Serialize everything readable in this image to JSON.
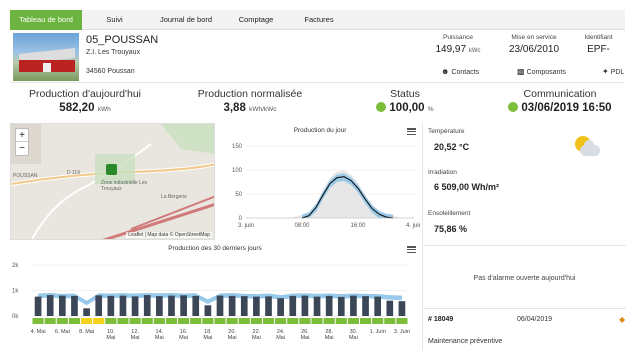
{
  "tabs": [
    {
      "label": "Tableau de bord",
      "active": true
    },
    {
      "label": "Suivi",
      "active": false
    },
    {
      "label": "Journal de bord",
      "active": false
    },
    {
      "label": "Comptage",
      "active": false
    },
    {
      "label": "Factures",
      "active": false
    }
  ],
  "site": {
    "name": "05_POUSSAN",
    "address_line1": "Z.I. Les Trouyaux",
    "address_line2": "34560 Poussan",
    "power_label": "Puissance",
    "power_value": "149,97",
    "power_unit": "kWc",
    "service_label": "Mise en service",
    "service_value": "23/06/2010",
    "id_label": "Identifiant",
    "id_value": "EPF-",
    "contacts_label": "Contacts",
    "components_label": "Composants",
    "pdl_label": "PDL"
  },
  "kpis": {
    "production_label": "Production d'aujourd'hui",
    "production_value": "582,20",
    "production_unit": "kWh",
    "normalized_label": "Production normalisée",
    "normalized_value": "3,88",
    "normalized_unit": "kWh/kWc",
    "status_label": "Status",
    "status_value": "100,00",
    "status_unit": "%",
    "comm_label": "Communication",
    "comm_value": "03/06/2019 16:50",
    "status_color": "#7cbd3a"
  },
  "map": {
    "zoom_in": "+",
    "zoom_out": "−",
    "attribution": "Leaflet | Map data © OpenStreetMap",
    "labels": [
      "D 119",
      "POUSSAN",
      "Zone industrielle Les Trouyaux",
      "La Bergerie"
    ]
  },
  "day_chart": {
    "title": "Production du jour",
    "y_ticks": [
      "150",
      "100",
      "50",
      "0"
    ],
    "x_ticks": [
      "3. juin",
      "08:00",
      "16:00",
      "4. juin"
    ],
    "colors": {
      "line": "#111111",
      "band": "#8cc3e8",
      "reference": "#dddddd"
    }
  },
  "chart_data": [
    {
      "type": "line",
      "title": "Production du jour",
      "xlabel": "",
      "ylabel": "",
      "ylim": [
        0,
        150
      ],
      "x_ticks": [
        "3. juin",
        "08:00",
        "16:00",
        "4. juin"
      ],
      "series": [
        {
          "x": [
            8,
            9,
            10,
            11,
            12,
            13,
            14,
            15,
            16,
            17,
            18,
            19,
            20,
            21
          ],
          "values": [
            0,
            5,
            22,
            48,
            72,
            84,
            86,
            78,
            62,
            40,
            20,
            8,
            2,
            0
          ]
        }
      ]
    },
    {
      "type": "bar",
      "title": "Production des 30 derniers jours",
      "xlabel": "",
      "ylabel": "",
      "ylim": [
        0,
        2000
      ],
      "y_ticks": [
        "2k",
        "1k",
        "0k"
      ],
      "categories": [
        "4. Mai",
        "5",
        "6. Mai",
        "7",
        "8. Mai",
        "9",
        "10. Mai",
        "11",
        "12. Mai",
        "13",
        "14. Mai",
        "15",
        "16. Mai",
        "17",
        "18. Mai",
        "19",
        "20. Mai",
        "21",
        "22. Mai",
        "23",
        "24. Mai",
        "25",
        "26. Mai",
        "27",
        "28. Mai",
        "29",
        "30. Mai",
        "31",
        "1. Juin",
        "2",
        "3. Juin"
      ],
      "values": [
        760,
        820,
        800,
        790,
        300,
        810,
        790,
        800,
        770,
        820,
        780,
        800,
        810,
        790,
        420,
        800,
        790,
        780,
        760,
        770,
        700,
        790,
        800,
        760,
        790,
        750,
        800,
        780,
        760,
        600,
        580
      ],
      "band_values": [
        880,
        900,
        870,
        880,
        600,
        890,
        880,
        900,
        880,
        900,
        890,
        900,
        880,
        890,
        650,
        880,
        900,
        870,
        860,
        880,
        820,
        880,
        890,
        870,
        880,
        860,
        880,
        870,
        860,
        820,
        800
      ],
      "status_colors": [
        "#7cbd3a",
        "#7cbd3a",
        "#7cbd3a",
        "#7cbd3a",
        "#f2d21a",
        "#f2d21a",
        "#7cbd3a",
        "#7cbd3a",
        "#7cbd3a",
        "#7cbd3a",
        "#7cbd3a",
        "#7cbd3a",
        "#7cbd3a",
        "#7cbd3a",
        "#7cbd3a",
        "#7cbd3a",
        "#7cbd3a",
        "#7cbd3a",
        "#7cbd3a",
        "#7cbd3a",
        "#7cbd3a",
        "#7cbd3a",
        "#7cbd3a",
        "#7cbd3a",
        "#7cbd3a",
        "#7cbd3a",
        "#7cbd3a",
        "#7cbd3a",
        "#7cbd3a",
        "#7cbd3a",
        "#7cbd3a"
      ]
    }
  ],
  "month_chart": {
    "title": "Production des 30 derniers jours",
    "x_ticks": [
      {
        "top": "4. Mai",
        "bottom": ""
      },
      {
        "top": "6. Mai",
        "bottom": ""
      },
      {
        "top": "8. Mai",
        "bottom": ""
      },
      {
        "top": "10.",
        "bottom": "Mai"
      },
      {
        "top": "12.",
        "bottom": "Mai"
      },
      {
        "top": "14.",
        "bottom": "Mai"
      },
      {
        "top": "16.",
        "bottom": "Mai"
      },
      {
        "top": "18.",
        "bottom": "Mai"
      },
      {
        "top": "20.",
        "bottom": "Mai"
      },
      {
        "top": "22.",
        "bottom": "Mai"
      },
      {
        "top": "24.",
        "bottom": "Mai"
      },
      {
        "top": "26.",
        "bottom": "Mai"
      },
      {
        "top": "28.",
        "bottom": "Mai"
      },
      {
        "top": "30.",
        "bottom": "Mai"
      },
      {
        "top": "1. Juin",
        "bottom": ""
      },
      {
        "top": "3. Juin",
        "bottom": ""
      }
    ],
    "colors": {
      "bar": "#3b4656",
      "band": "#8cc3e8"
    }
  },
  "weather": {
    "temp_label": "Température",
    "temp_value": "20,52 °C",
    "irr_label": "Irradiation",
    "irr_value": "6 509,00 Wh/m²",
    "sun_label": "Ensoleillement",
    "sun_value": "75,86 %",
    "icon": "sun-cloud-icon"
  },
  "alarms": {
    "text": "Pas d'alarme ouverte aujourd'hui"
  },
  "maintenance": {
    "id": "# 18049",
    "date": "06/04/2019",
    "type": "Maintenance préventive"
  }
}
